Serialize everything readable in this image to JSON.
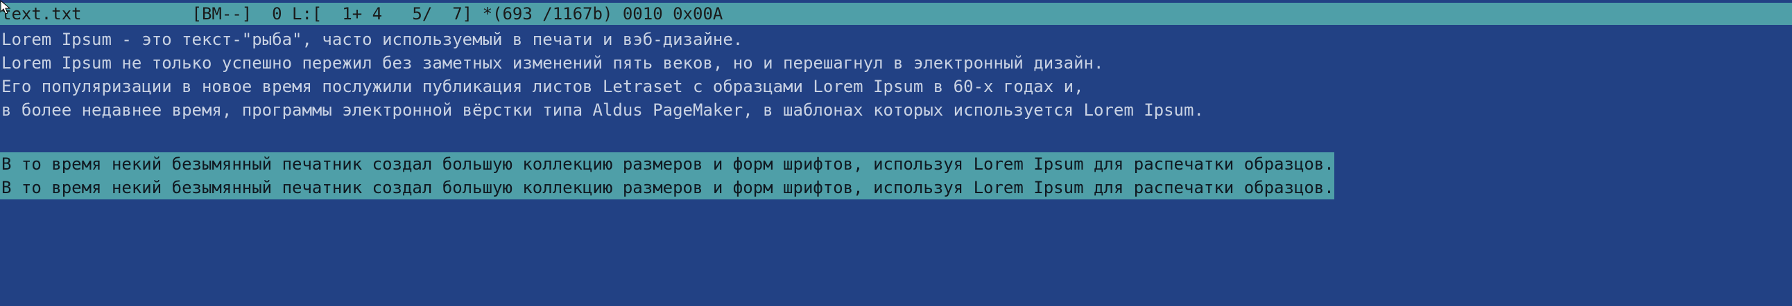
{
  "status_bar": {
    "text": "text.txt           [BM--]  0 L:[  1+ 4   5/  7] *(693 /1167b) 0010 0x00A"
  },
  "editor": {
    "lines": [
      "Lorem Ipsum - это текст-\"рыба\", часто используемый в печати и вэб-дизайне.",
      "Lorem Ipsum не только успешно пережил без заметных изменений пять веков, но и перешагнул в электронный дизайн.",
      "Его популяризации в новое время послужили публикация листов Letraset с образцами Lorem Ipsum в 60-х годах и,",
      "в более недавнее время, программы электронной вёрстки типа Aldus PageMaker, в шаблонах которых используется Lorem Ipsum.",
      "",
      "В то время некий безымянный печатник создал большую коллекцию размеров и форм шрифтов, используя Lorem Ipsum для распечатки образцов.",
      "В то время некий безымянный печатник создал большую коллекцию размеров и форм шрифтов, используя Lorem Ipsum для распечатки образцов."
    ],
    "selected_lines": [
      5,
      6
    ]
  },
  "colors": {
    "background": "#224184",
    "text": "#c9d2e3",
    "selection_bg": "#4f9fa8",
    "selection_text": "#101820"
  }
}
